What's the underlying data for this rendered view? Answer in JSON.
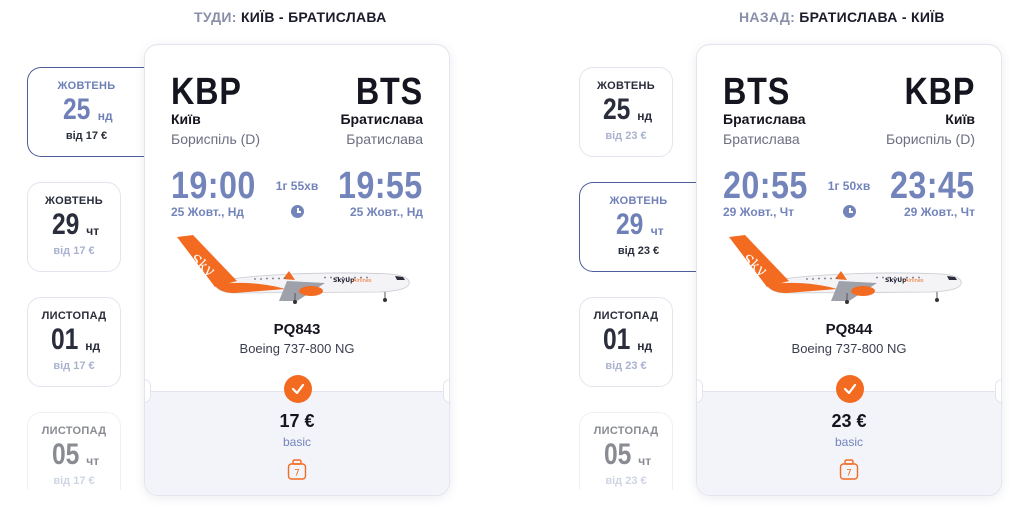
{
  "outbound": {
    "heading_prefix": "ТУДИ:",
    "heading_route": "КИЇВ - БРАТИСЛАВА",
    "dates": [
      {
        "month": "ЖОВТЕНЬ",
        "day": "25",
        "weekday": "нд",
        "price": "від 17 €",
        "selected": true
      },
      {
        "month": "ЖОВТЕНЬ",
        "day": "29",
        "weekday": "чт",
        "price": "від 17 €",
        "selected": false
      },
      {
        "month": "ЛИСТОПАД",
        "day": "01",
        "weekday": "нд",
        "price": "від 17 €",
        "selected": false
      },
      {
        "month": "ЛИСТОПАД",
        "day": "05",
        "weekday": "чт",
        "price": "від 17 €",
        "selected": false
      }
    ],
    "card": {
      "from_code": "KBP",
      "from_city": "Київ",
      "from_airport": "Бориспіль (D)",
      "to_code": "BTS",
      "to_city": "Братислава",
      "to_airport": "Братислава",
      "dep_time": "19:00",
      "dep_date": "25 Жовт., Нд",
      "arr_time": "19:55",
      "arr_date": "25 Жовт., Нд",
      "duration": "1г 55хв",
      "flight_no": "PQ843",
      "aircraft": "Boeing 737-800 NG",
      "price": "17 €",
      "tariff": "basic",
      "bag_kg": "7"
    }
  },
  "inbound": {
    "heading_prefix": "НАЗАД:",
    "heading_route": "БРАТИСЛАВА - КИЇВ",
    "dates": [
      {
        "month": "ЖОВТЕНЬ",
        "day": "25",
        "weekday": "нд",
        "price": "від 23 €",
        "selected": false
      },
      {
        "month": "ЖОВТЕНЬ",
        "day": "29",
        "weekday": "чт",
        "price": "від 23 €",
        "selected": true
      },
      {
        "month": "ЛИСТОПАД",
        "day": "01",
        "weekday": "нд",
        "price": "від 23 €",
        "selected": false
      },
      {
        "month": "ЛИСТОПАД",
        "day": "05",
        "weekday": "чт",
        "price": "від 23 €",
        "selected": false
      }
    ],
    "card": {
      "from_code": "BTS",
      "from_city": "Братислава",
      "from_airport": "Братислава",
      "to_code": "KBP",
      "to_city": "Київ",
      "to_airport": "Бориспіль (D)",
      "dep_time": "20:55",
      "dep_date": "29 Жовт., Чт",
      "arr_time": "23:45",
      "arr_date": "29 Жовт., Чт",
      "duration": "1г 50хв",
      "flight_no": "PQ844",
      "aircraft": "Boeing 737-800 NG",
      "price": "23 €",
      "tariff": "basic",
      "bag_kg": "7"
    }
  },
  "colors": {
    "accent_orange": "#f26b21",
    "time_blue": "#7384bb",
    "selected_border": "#4d5f9a"
  },
  "icons": [
    "check-icon",
    "clock-icon",
    "baggage-icon",
    "airplane-image"
  ]
}
